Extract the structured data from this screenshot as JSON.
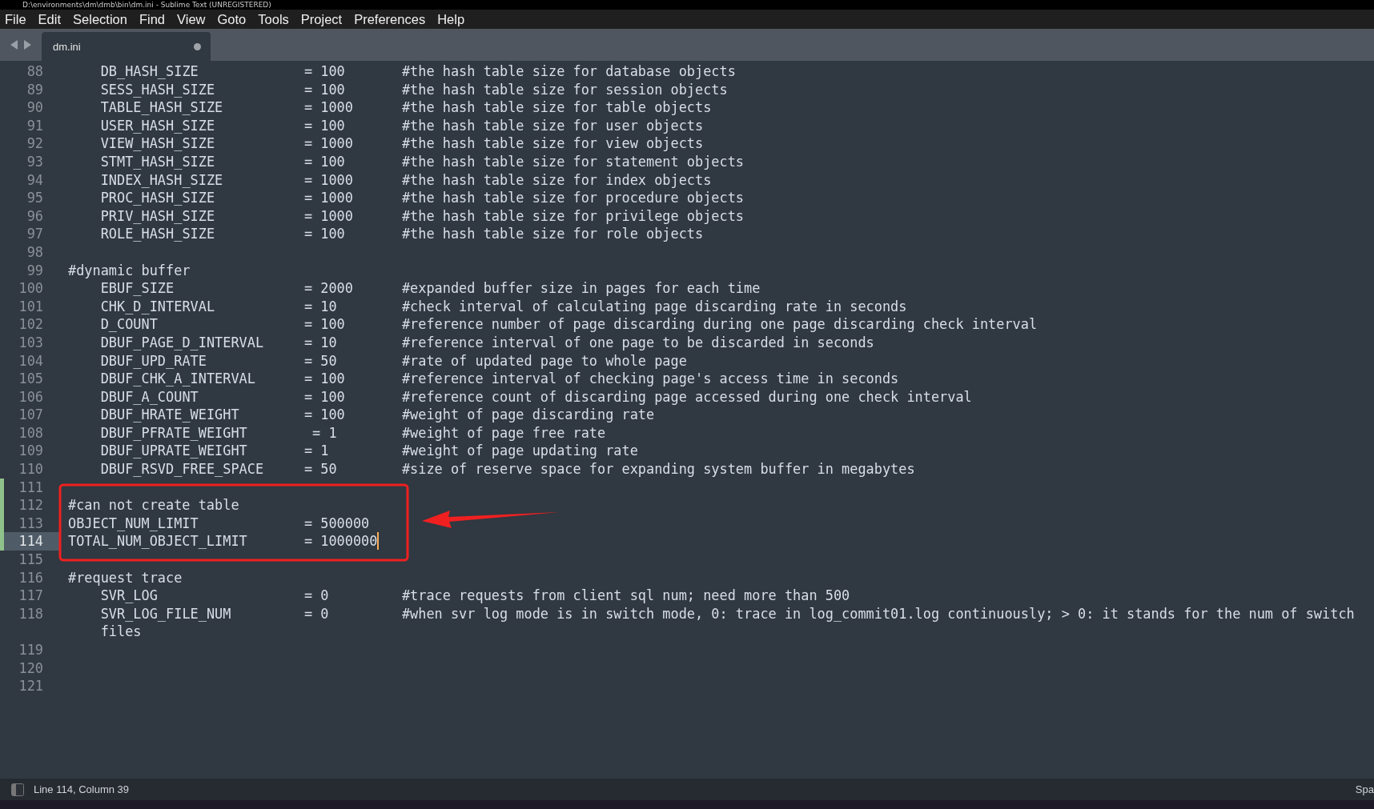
{
  "window": {
    "title": "D:\\environments\\dm\\dmb\\bin\\dm.ini - Sublime Text (UNREGISTERED)"
  },
  "menu": [
    "File",
    "Edit",
    "Selection",
    "Find",
    "View",
    "Goto",
    "Tools",
    "Project",
    "Preferences",
    "Help"
  ],
  "tabs": [
    {
      "label": "dm.ini",
      "selected": true,
      "dirty": true
    }
  ],
  "lines": [
    {
      "number": "88",
      "text": "    DB_HASH_SIZE             = 100       #the hash table size for database objects",
      "modified": false,
      "current": false
    },
    {
      "number": "89",
      "text": "    SESS_HASH_SIZE           = 100       #the hash table size for session objects",
      "modified": false,
      "current": false
    },
    {
      "number": "90",
      "text": "    TABLE_HASH_SIZE          = 1000      #the hash table size for table objects",
      "modified": false,
      "current": false
    },
    {
      "number": "91",
      "text": "    USER_HASH_SIZE           = 100       #the hash table size for user objects",
      "modified": false,
      "current": false
    },
    {
      "number": "92",
      "text": "    VIEW_HASH_SIZE           = 1000      #the hash table size for view objects",
      "modified": false,
      "current": false
    },
    {
      "number": "93",
      "text": "    STMT_HASH_SIZE           = 100       #the hash table size for statement objects",
      "modified": false,
      "current": false
    },
    {
      "number": "94",
      "text": "    INDEX_HASH_SIZE          = 1000      #the hash table size for index objects",
      "modified": false,
      "current": false
    },
    {
      "number": "95",
      "text": "    PROC_HASH_SIZE           = 1000      #the hash table size for procedure objects",
      "modified": false,
      "current": false
    },
    {
      "number": "96",
      "text": "    PRIV_HASH_SIZE           = 1000      #the hash table size for privilege objects",
      "modified": false,
      "current": false
    },
    {
      "number": "97",
      "text": "    ROLE_HASH_SIZE           = 100       #the hash table size for role objects",
      "modified": false,
      "current": false
    },
    {
      "number": "98",
      "modified": false,
      "current": false
    },
    {
      "number": "99",
      "text": "#dynamic buffer",
      "modified": false,
      "current": false
    },
    {
      "number": "100",
      "text": "    EBUF_SIZE                = 2000      #expanded buffer size in pages for each time",
      "modified": false,
      "current": false
    },
    {
      "number": "101",
      "text": "    CHK_D_INTERVAL           = 10        #check interval of calculating page discarding rate in seconds",
      "modified": false,
      "current": false
    },
    {
      "number": "102",
      "text": "    D_COUNT                  = 100       #reference number of page discarding during one page discarding check interval",
      "modified": false,
      "current": false
    },
    {
      "number": "103",
      "text": "    DBUF_PAGE_D_INTERVAL     = 10        #reference interval of one page to be discarded in seconds",
      "modified": false,
      "current": false
    },
    {
      "number": "104",
      "text": "    DBUF_UPD_RATE            = 50        #rate of updated page to whole page",
      "modified": false,
      "current": false
    },
    {
      "number": "105",
      "text": "    DBUF_CHK_A_INTERVAL      = 100       #reference interval of checking page's access time in seconds",
      "modified": false,
      "current": false
    },
    {
      "number": "106",
      "text": "    DBUF_A_COUNT             = 100       #reference count of discarding page accessed during one check interval",
      "modified": false,
      "current": false
    },
    {
      "number": "107",
      "text": "    DBUF_HRATE_WEIGHT        = 100       #weight of page discarding rate",
      "modified": false,
      "current": false
    },
    {
      "number": "108",
      "text": "    DBUF_PFRATE_WEIGHT        = 1        #weight of page free rate",
      "modified": false,
      "current": false
    },
    {
      "number": "109",
      "text": "    DBUF_UPRATE_WEIGHT       = 1         #weight of page updating rate",
      "modified": false,
      "current": false
    },
    {
      "number": "110",
      "text": "    DBUF_RSVD_FREE_SPACE     = 50        #size of reserve space for expanding system buffer in megabytes",
      "modified": false,
      "current": false
    },
    {
      "number": "111",
      "modified": true,
      "current": false
    },
    {
      "number": "112",
      "text": "#can not create table",
      "modified": true,
      "current": false
    },
    {
      "number": "113",
      "text": "OBJECT_NUM_LIMIT             = 500000",
      "modified": true,
      "current": false
    },
    {
      "number": "114",
      "text": "TOTAL_NUM_OBJECT_LIMIT       = 1000000",
      "modified": true,
      "current": true
    },
    {
      "number": "115",
      "modified": false,
      "current": false
    },
    {
      "number": "116",
      "text": "#request trace",
      "modified": false,
      "current": false
    },
    {
      "number": "117",
      "text": "    SVR_LOG                  = 0         #trace requests from client sql num; need more than 500",
      "modified": false,
      "current": false
    },
    {
      "number": "118",
      "text": "    SVR_LOG_FILE_NUM         = 0         #when svr log mode is in switch mode, 0: trace in log_commit01.log continuously; > 0: it stands for the num of switch files",
      "modified": false,
      "current": false
    },
    {
      "number": "119",
      "modified": false,
      "current": false
    },
    {
      "number": "120",
      "modified": false,
      "current": false
    },
    {
      "number": "121",
      "modified": false,
      "current": false
    }
  ],
  "status_bar": {
    "position": "Line 114, Column 39",
    "indentation": "Spa"
  }
}
